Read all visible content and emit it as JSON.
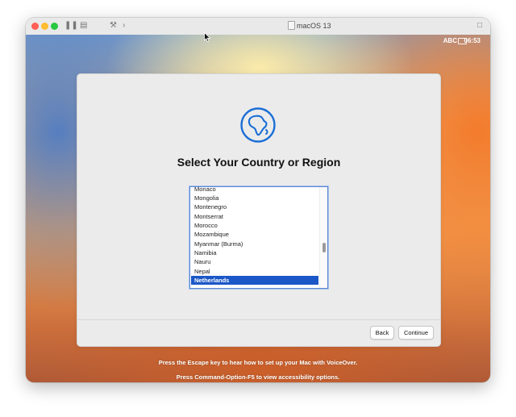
{
  "window": {
    "title": "macOS 13"
  },
  "menubar": {
    "input_source": "ABC",
    "time": "06:53"
  },
  "setup": {
    "heading": "Select Your Country or Region",
    "countries": [
      "Monaco",
      "Mongolia",
      "Montenegro",
      "Montserrat",
      "Morocco",
      "Mozambique",
      "Myanmar (Burma)",
      "Namibia",
      "Nauru",
      "Nepal",
      "Netherlands"
    ],
    "selected": "Netherlands",
    "back_label": "Back",
    "continue_label": "Continue"
  },
  "hints": {
    "voiceover": "Press the Escape key to hear how to set up your Mac with VoiceOver.",
    "accessibility": "Press Command-Option-F5 to view accessibility options."
  },
  "colors": {
    "accent": "#1b57c7",
    "globe": "#1b6fd6"
  }
}
